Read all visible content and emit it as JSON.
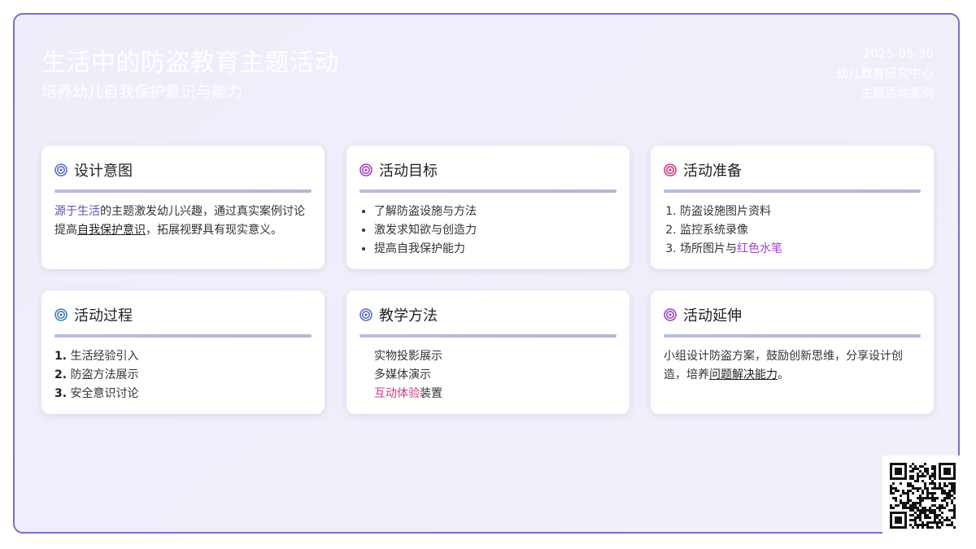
{
  "header": {
    "title": "生活中的防盗教育主题活动",
    "subtitle": "培养幼儿自我保护意识与能力",
    "date": "2025-05-30",
    "org": "幼儿教育研究中心",
    "category": "主题活动案例"
  },
  "colors": {
    "frame_border": "#7a6fc4",
    "icon_blue": "#5a6ec8",
    "icon_purple": "#a043c6",
    "icon_pink": "#d23780",
    "icon_steelblue": "#3f7ec0"
  },
  "cards": {
    "design": {
      "title": "设计意图",
      "icon": "target-icon",
      "p1": "源于生活",
      "p2": "的主题激发幼儿兴趣，通过真实案例讨论",
      "p3": "提高",
      "p4": "自我保护意识",
      "p5": "，拓展视野具有现实意义。"
    },
    "goals": {
      "title": "活动目标",
      "icon": "target-icon",
      "items": [
        "了解防盗设施与方法",
        "激发求知欲与创造力",
        "提高自我保护能力"
      ]
    },
    "prep": {
      "title": "活动准备",
      "icon": "target-icon",
      "items": [
        "防盗设施图片资料",
        "监控系统录像"
      ],
      "item3_a": "场所图片与",
      "item3_b": "红色水笔"
    },
    "process": {
      "title": "活动过程",
      "icon": "target-icon",
      "steps": [
        {
          "num": "1.",
          "text": "生活经验引入"
        },
        {
          "num": "2.",
          "text": "防盗方法展示"
        },
        {
          "num": "3.",
          "text": "安全意识讨论"
        }
      ]
    },
    "methods": {
      "title": "教学方法",
      "icon": "target-icon",
      "items": [
        "实物投影展示",
        "多媒体演示"
      ],
      "item3_a": "互动体验",
      "item3_b": "装置"
    },
    "extension": {
      "title": "活动延伸",
      "icon": "target-icon",
      "p1": "小组设计防盗方案，鼓励创新思维，分享设计创造，培养",
      "p2": "问题解决能力",
      "p3": "。"
    }
  },
  "qr": {
    "icon": "qr-code-icon"
  }
}
